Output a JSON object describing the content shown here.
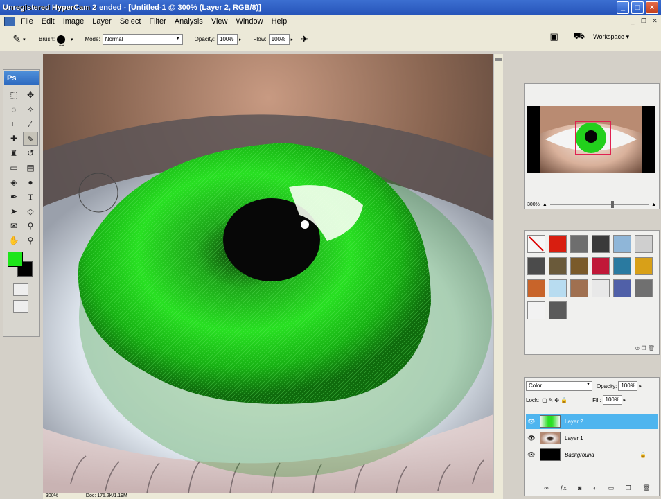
{
  "window": {
    "watermark": "Unregistered HyperCam 2",
    "title": "ended - [Untitled-1 @ 300% (Layer 2, RGB/8)]",
    "minimize": "_",
    "maximize": "□",
    "close": "×"
  },
  "menu": [
    "File",
    "Edit",
    "Image",
    "Layer",
    "Select",
    "Filter",
    "Analysis",
    "View",
    "Window",
    "Help"
  ],
  "options": {
    "brush_label": "Brush:",
    "brush_size": "20",
    "mode_label": "Mode:",
    "mode_value": "Normal",
    "opacity_label": "Opacity:",
    "opacity_value": "100%",
    "flow_label": "Flow:",
    "flow_value": "100%",
    "workspace_label": "Workspace ▾"
  },
  "toolbox": {
    "logo": "Ps",
    "foreground_color": "#1ee61a",
    "background_color": "#000000"
  },
  "navigator": {
    "zoom": "300%"
  },
  "styles": {
    "swatches": [
      "#f6f6f6",
      "#d81e10",
      "#6e6e6e",
      "#3a3a3a",
      "#8fb6d8",
      "#cfcfcf",
      "#4b4b4b",
      "#6a5a3a",
      "#7a5a2a",
      "#c01838",
      "#2a7aa0",
      "#d8a018",
      "#c8642a",
      "#b8dcf0",
      "#a07050",
      "#e8e8e8",
      "#5060a8",
      "#707070",
      "#f2f2f2",
      "#5a5a5a"
    ]
  },
  "layers": {
    "blend_mode": "Color",
    "opacity_label": "Opacity:",
    "opacity_value": "100%",
    "lock_label": "Lock:",
    "fill_label": "Fill:",
    "fill_value": "100%",
    "items": [
      {
        "name": "Layer 2",
        "active": true
      },
      {
        "name": "Layer 1",
        "active": false
      },
      {
        "name": "Background",
        "active": false
      }
    ]
  },
  "status": {
    "zoom": "300%",
    "doc": "Doc: 175.2K/1.19M"
  }
}
